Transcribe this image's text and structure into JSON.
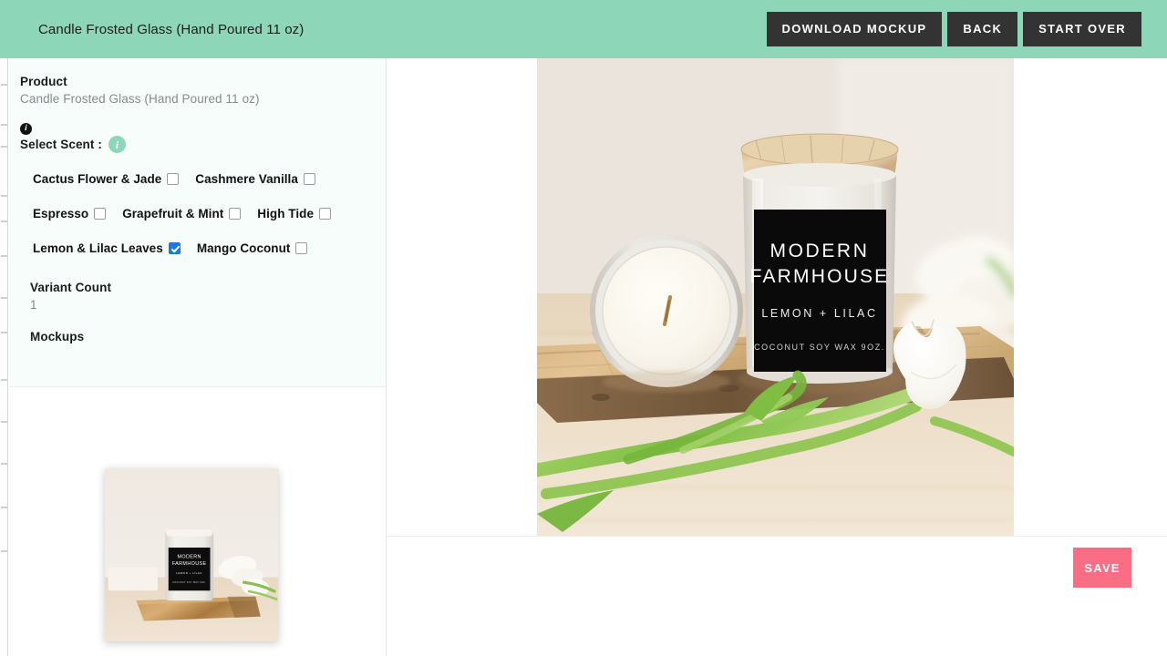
{
  "header": {
    "title": "Candle Frosted Glass (Hand Poured 11 oz)",
    "buttons": {
      "download": "DOWNLOAD MOCKUP",
      "back": "BACK",
      "start_over": "START OVER"
    },
    "background_color": "#8ed6b8",
    "button_color": "#333333"
  },
  "sidebar": {
    "product_label": "Product",
    "product_value": "Candle Frosted Glass (Hand Poured 11 oz)",
    "info_icon_glyph": "i",
    "scent_label": "Select Scent :",
    "scent_badge_glyph": "i",
    "scent_badge_color": "#8ed6b8",
    "scent_rows": [
      [
        {
          "label": "Cactus Flower & Jade",
          "checked": false
        },
        {
          "label": "Cashmere Vanilla",
          "checked": false
        }
      ],
      [
        {
          "label": "Espresso",
          "checked": false
        },
        {
          "label": "Grapefruit & Mint",
          "checked": false
        },
        {
          "label": "High Tide",
          "checked": false
        }
      ],
      [
        {
          "label": "Lemon & Lilac Leaves",
          "checked": true
        },
        {
          "label": "Mango Coconut",
          "checked": false
        }
      ]
    ],
    "variant_count_label": "Variant Count",
    "variant_count_value": "1",
    "mockups_label": "Mockups"
  },
  "mockup": {
    "label_brand_line1": "MODERN",
    "label_brand_line2": "FARMHOUSE",
    "label_scent": "LEMON + LILAC",
    "label_detail": "COCONUT SOY WAX 9OZ."
  },
  "footer": {
    "save_label": "SAVE",
    "save_color": "#fa6e85"
  }
}
